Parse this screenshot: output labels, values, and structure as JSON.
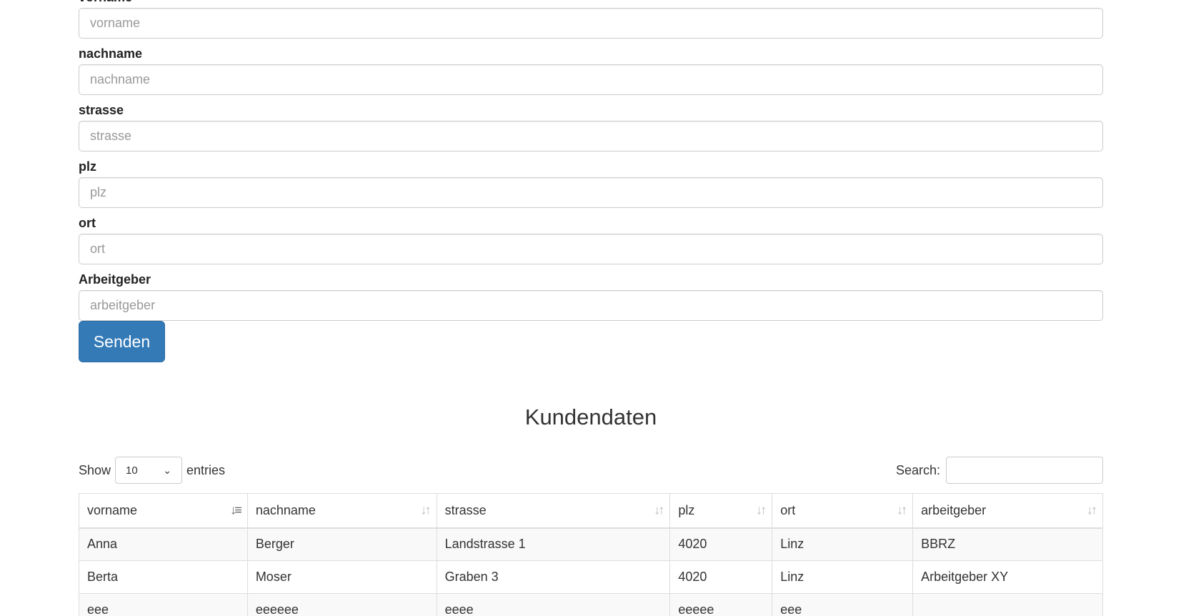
{
  "form": {
    "fields": [
      {
        "label": "vorname",
        "placeholder": "vorname"
      },
      {
        "label": "nachname",
        "placeholder": "nachname"
      },
      {
        "label": "strasse",
        "placeholder": "strasse"
      },
      {
        "label": "plz",
        "placeholder": "plz"
      },
      {
        "label": "ort",
        "placeholder": "ort"
      },
      {
        "label": "Arbeitgeber",
        "placeholder": "arbeitgeber"
      }
    ],
    "submit_label": "Senden"
  },
  "section": {
    "title": "Kundendaten"
  },
  "table_controls": {
    "show_label": "Show",
    "length_value": "10",
    "entries_label": "entries",
    "search_label": "Search:",
    "search_value": ""
  },
  "table": {
    "columns": [
      "vorname",
      "nachname",
      "strasse",
      "plz",
      "ort",
      "arbeitgeber"
    ],
    "sorted_column": "vorname",
    "rows": [
      [
        "Anna",
        "Berger",
        "Landstrasse 1",
        "4020",
        "Linz",
        "BBRZ"
      ],
      [
        "Berta",
        "Moser",
        "Graben 3",
        "4020",
        "Linz",
        "Arbeitgeber XY"
      ],
      [
        "eee",
        "eeeeee",
        "eeee",
        "eeeee",
        "eee",
        ""
      ]
    ]
  },
  "colors": {
    "primary_button": "#337ab7",
    "border": "#dddddd",
    "striped_row": "#f9f9f9"
  }
}
